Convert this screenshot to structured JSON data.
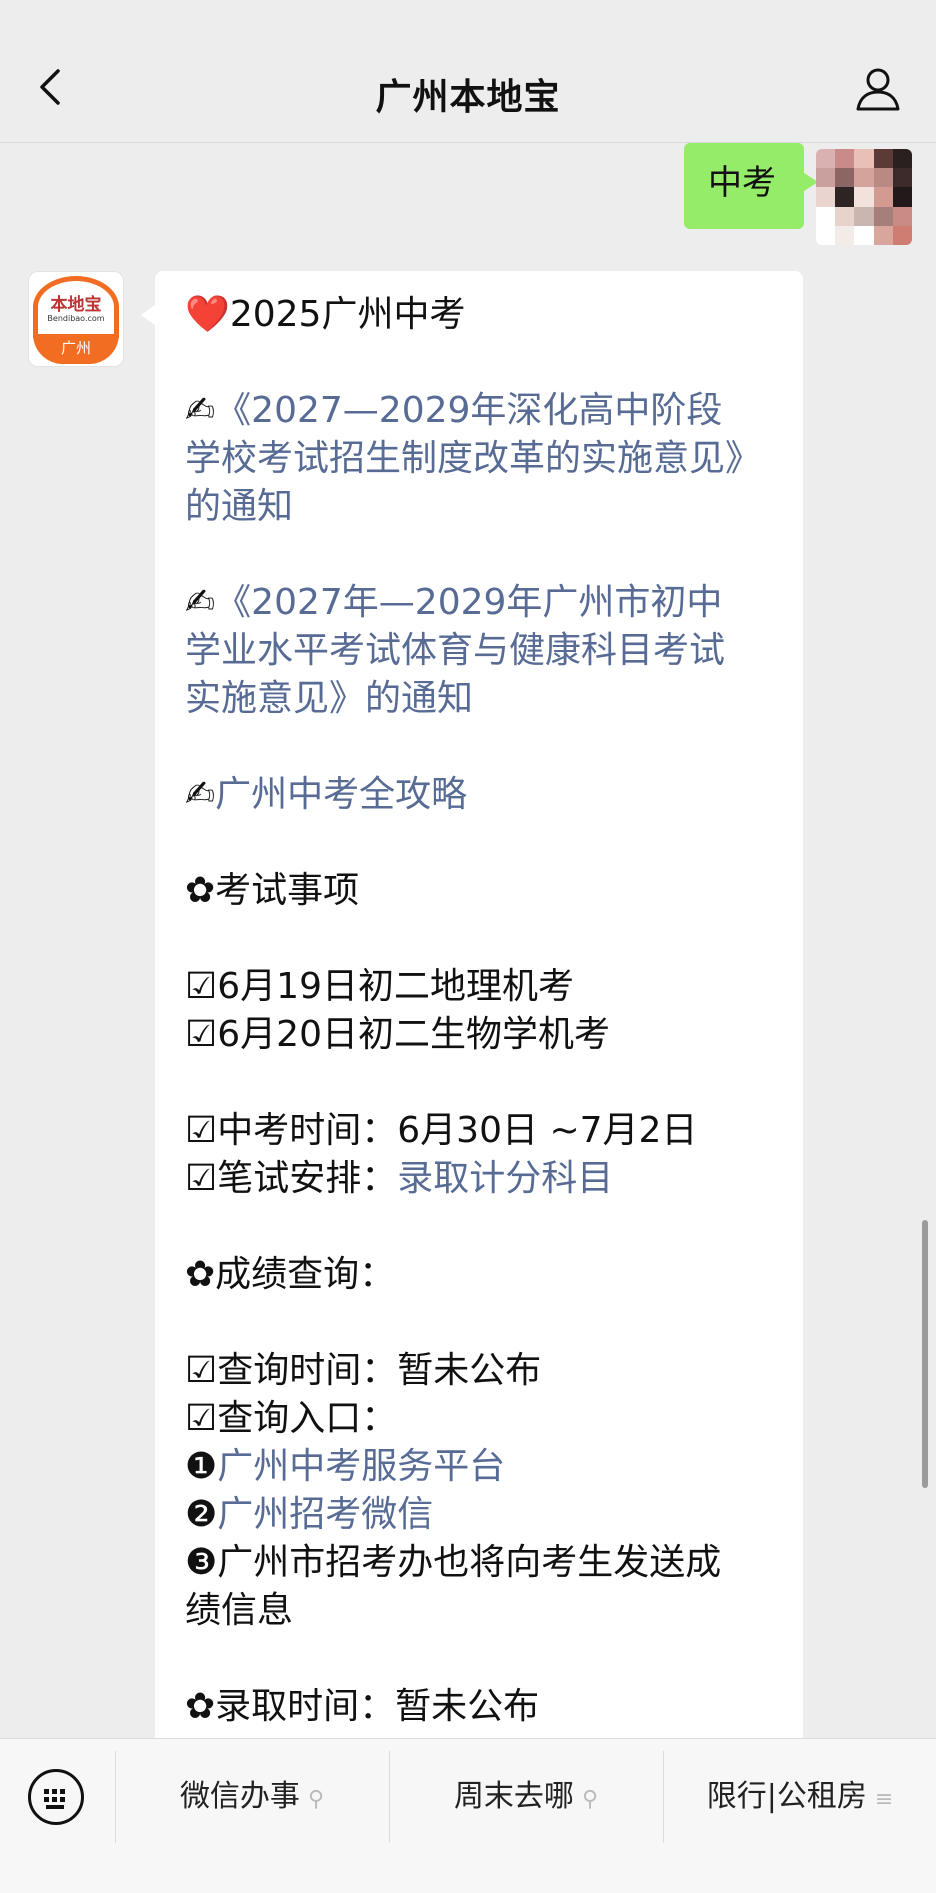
{
  "nav": {
    "title": "广州本地宝"
  },
  "chat": {
    "outgoing_message": "中考",
    "incoming": {
      "title_emoji": "❤️",
      "title": "2025广州中考",
      "writing_emoji": "✍",
      "link1_lines": [
        "《2027—2029年深化高中阶段",
        "学校考试招生制度改革的实施意见》",
        "的通知"
      ],
      "link2_lines": [
        "《2027年—2029年广州市初中",
        "学业水平考试体育与健康科目考试",
        "实施意见》的通知"
      ],
      "link3": "广州中考全攻略",
      "flower": "✿",
      "check": "☑",
      "section1": "考试事项",
      "item1": "6月19日初二地理机考",
      "item2": "6月20日初二生物学机考",
      "item3": "中考时间：6月30日 ~7月2日",
      "item4_label": "笔试安排：",
      "item4_link": "录取计分科目",
      "section2": "成绩查询：",
      "item5": "查询时间：暂未公布",
      "item6": "查询入口：",
      "n1": "❶",
      "n2": "❷",
      "n3": "❸",
      "entry1_link": "广州中考服务平台",
      "entry2_link": "广州招考微信",
      "entry3_line1": "广州市招考办也将向考生发送成",
      "entry3_line2": "绩信息",
      "section3": "录取时间：暂未公布"
    }
  },
  "bottom_menu": {
    "items": [
      "微信办事",
      "周末去哪",
      "限行|公租房"
    ],
    "item1_icon": "link-icon",
    "item2_icon": "link-icon",
    "item3_icon": "menu-lines-icon"
  },
  "avatar_logo": {
    "main": "本地宝",
    "sub": "Bendibao.com",
    "city": "广州"
  },
  "colors": {
    "link": "#576b95",
    "outgoing_bubble": "#95ec69",
    "logo_orange": "#f26d21"
  }
}
